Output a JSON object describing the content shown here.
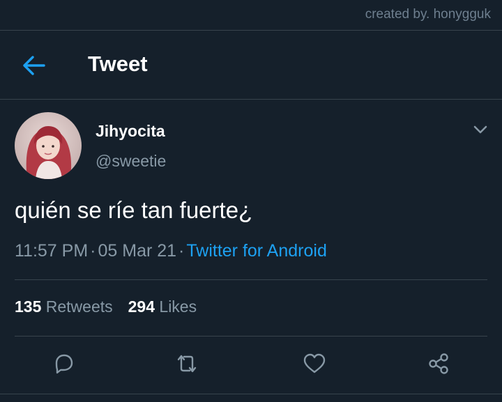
{
  "watermark": "created by. honygguk",
  "header": {
    "back_icon": "arrow-left-icon",
    "title": "Tweet"
  },
  "author": {
    "display_name": "Jihyocita",
    "handle": "@sweetie",
    "menu_icon": "chevron-down-icon"
  },
  "tweet": {
    "text": "quién se ríe tan fuerte¿",
    "time": "11:57 PM",
    "date": "05 Mar 21",
    "source": "Twitter for Android"
  },
  "stats": {
    "retweets_count": "135",
    "retweets_label": "Retweets",
    "likes_count": "294",
    "likes_label": "Likes"
  },
  "actions": [
    "reply-icon",
    "retweet-icon",
    "like-icon",
    "share-icon"
  ],
  "colors": {
    "background": "#15202b",
    "accent": "#1da1f2",
    "secondary_text": "#8899a6",
    "divider": "#38444d"
  }
}
